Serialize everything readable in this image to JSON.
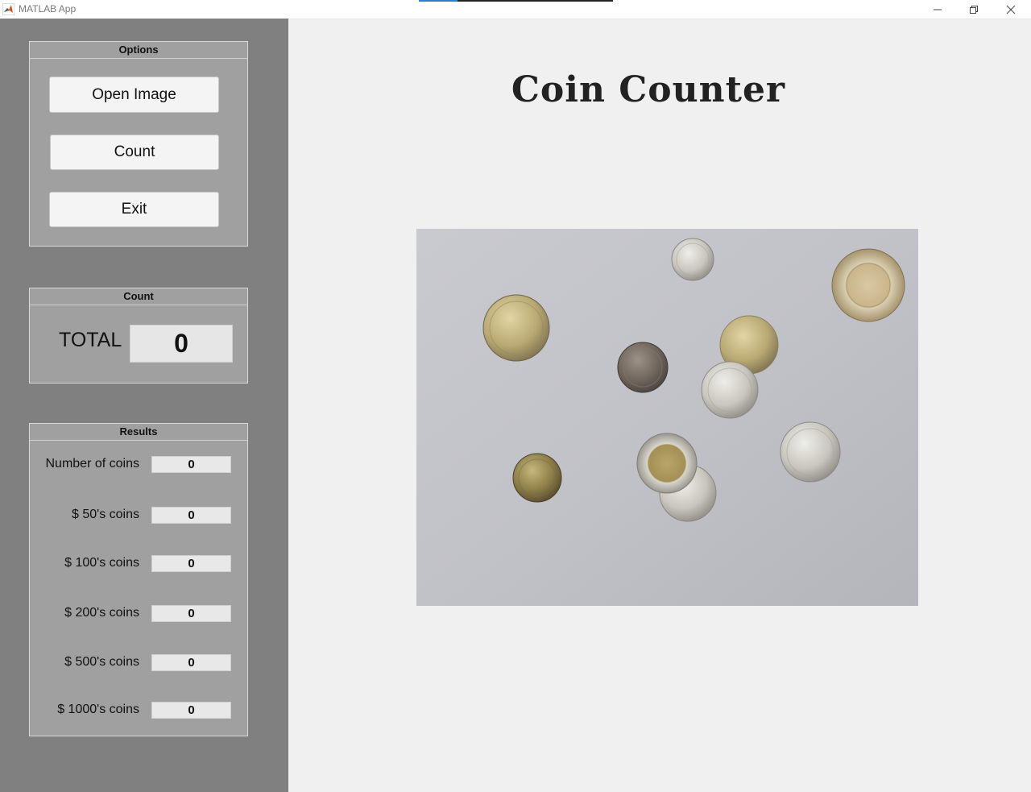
{
  "window": {
    "title": "MATLAB App"
  },
  "options_panel": {
    "title": "Options",
    "open_image_label": "Open Image",
    "count_label": "Count",
    "exit_label": "Exit"
  },
  "count_panel": {
    "title": "Count",
    "total_label": "TOTAL",
    "total_value": "0"
  },
  "results_panel": {
    "title": "Results",
    "rows": [
      {
        "label": "Number of coins",
        "value": "0"
      },
      {
        "label": "$ 50's coins",
        "value": "0"
      },
      {
        "label": "$ 100's coins",
        "value": "0"
      },
      {
        "label": "$ 200's coins",
        "value": "0"
      },
      {
        "label": "$ 500's coins",
        "value": "0"
      },
      {
        "label": "$ 1000's coins",
        "value": "0"
      }
    ]
  },
  "main": {
    "title": "Coin Counter"
  },
  "colors": {
    "sidebar": "#808080",
    "panel": "#a0a0a0",
    "background": "#f0f0f0"
  }
}
